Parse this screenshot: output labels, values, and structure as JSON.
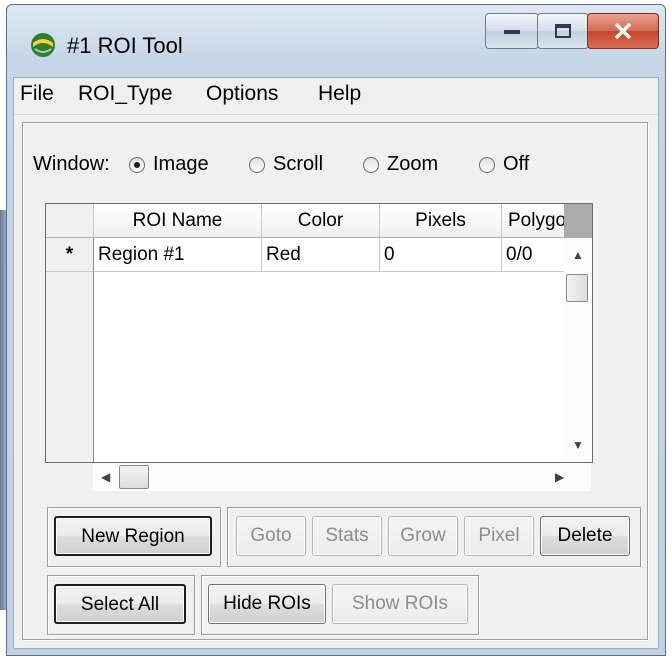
{
  "window": {
    "title": "#1 ROI Tool",
    "app_icon": "idl-roi-app-icon",
    "controls": [
      "minimize-icon",
      "maximize-icon",
      "close-icon"
    ]
  },
  "menu": [
    "File",
    "ROI_Type",
    "Options",
    "Help"
  ],
  "window_mode": {
    "label": "Window:",
    "options": [
      "Image",
      "Scroll",
      "Zoom",
      "Off"
    ],
    "selected": "Image"
  },
  "table": {
    "columns": [
      "ROI Name",
      "Color",
      "Pixels",
      "Polygo"
    ],
    "rows": [
      {
        "marker": "*",
        "name": "Region #1",
        "color": "Red",
        "pixels": "0",
        "polygons": "0/0"
      }
    ]
  },
  "buttons": {
    "new_region": "New Region",
    "goto": "Goto",
    "stats": "Stats",
    "grow": "Grow",
    "pixel": "Pixel",
    "delete": "Delete",
    "select_all": "Select All",
    "hide_rois": "Hide ROIs",
    "show_rois": "Show ROIs"
  }
}
